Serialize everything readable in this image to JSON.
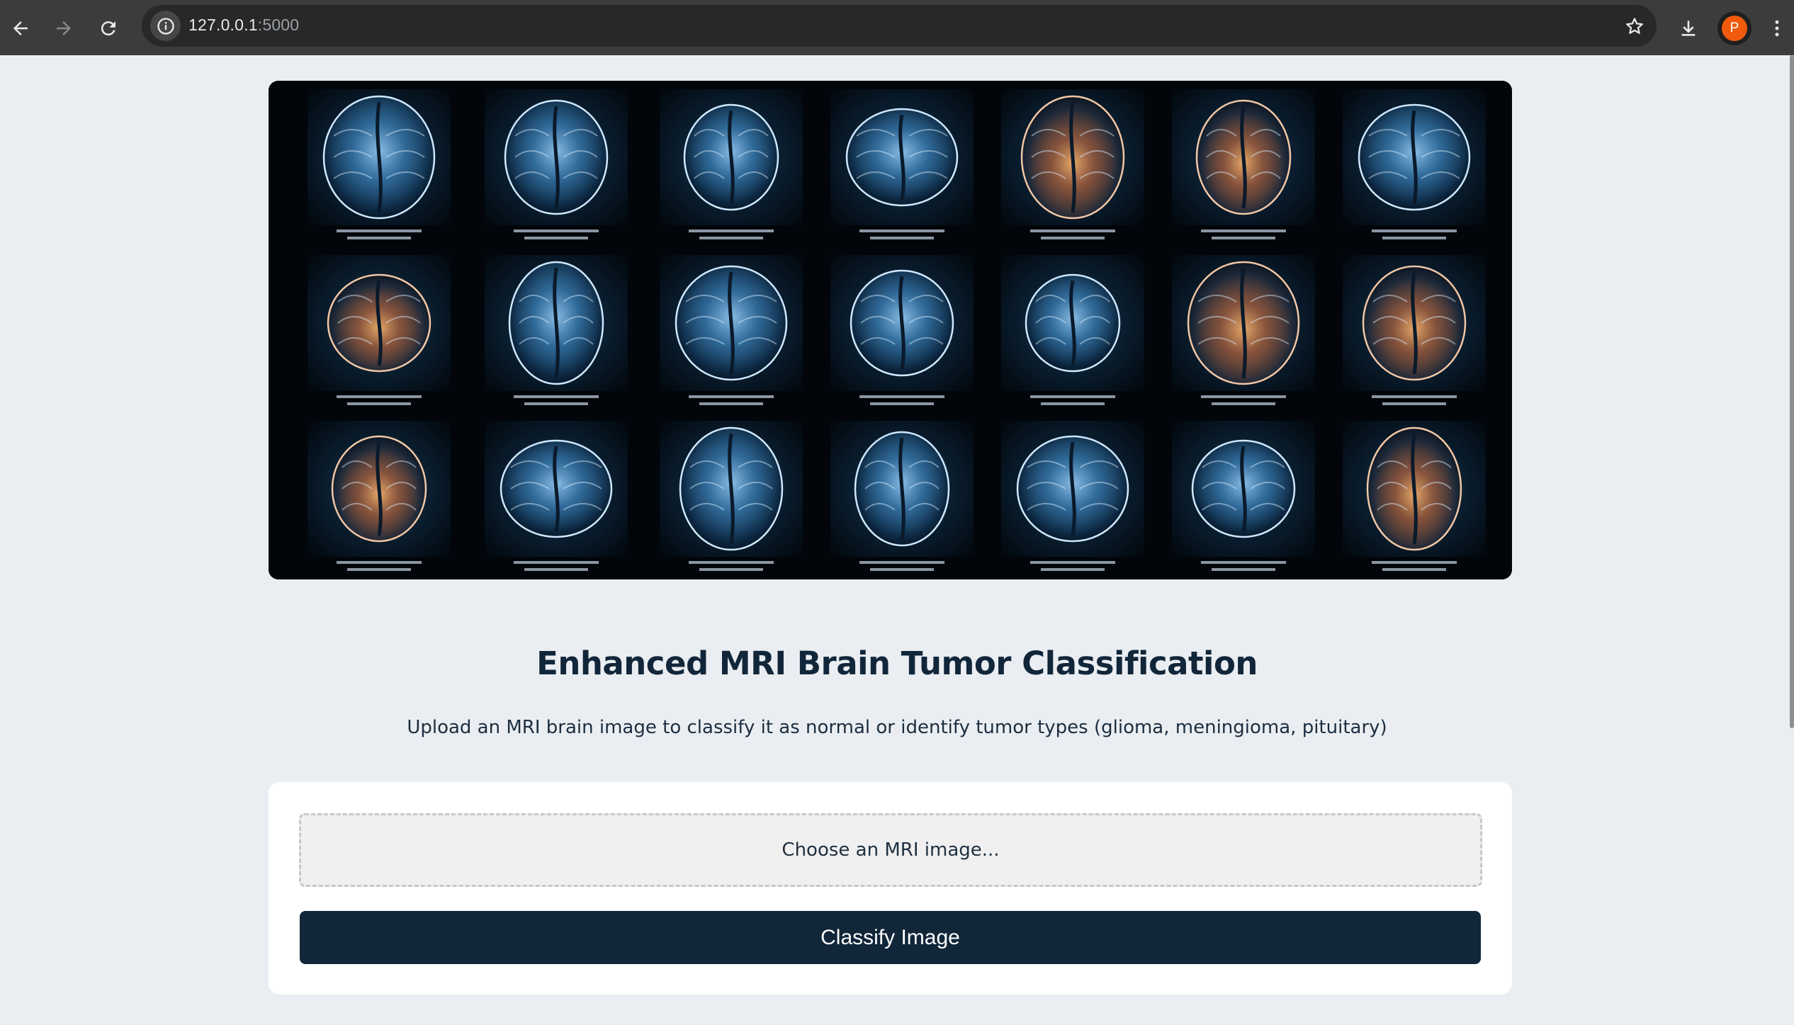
{
  "browser": {
    "url_host": "127.0.0.1",
    "url_port": ":5000",
    "profile_initial": "P"
  },
  "page": {
    "title": "Enhanced MRI Brain Tumor Classification",
    "subtitle": "Upload an MRI brain image to classify it as normal or identify tumor types (glioma, meningioma, pituitary)",
    "file_input_label": "Choose an MRI image...",
    "classify_button_label": "Classify Image"
  },
  "hero_image": {
    "rows": 3,
    "columns": 7,
    "tint": [
      "blue",
      "blue",
      "blue",
      "blue",
      "orange",
      "orange",
      "blue",
      "orange",
      "blue",
      "blue",
      "blue",
      "blue",
      "orange",
      "orange",
      "orange",
      "blue",
      "blue",
      "blue",
      "blue",
      "blue",
      "orange"
    ]
  },
  "colors": {
    "accent": "#12263a",
    "page_background": "#eaeef2",
    "profile": "#f15a0c"
  }
}
